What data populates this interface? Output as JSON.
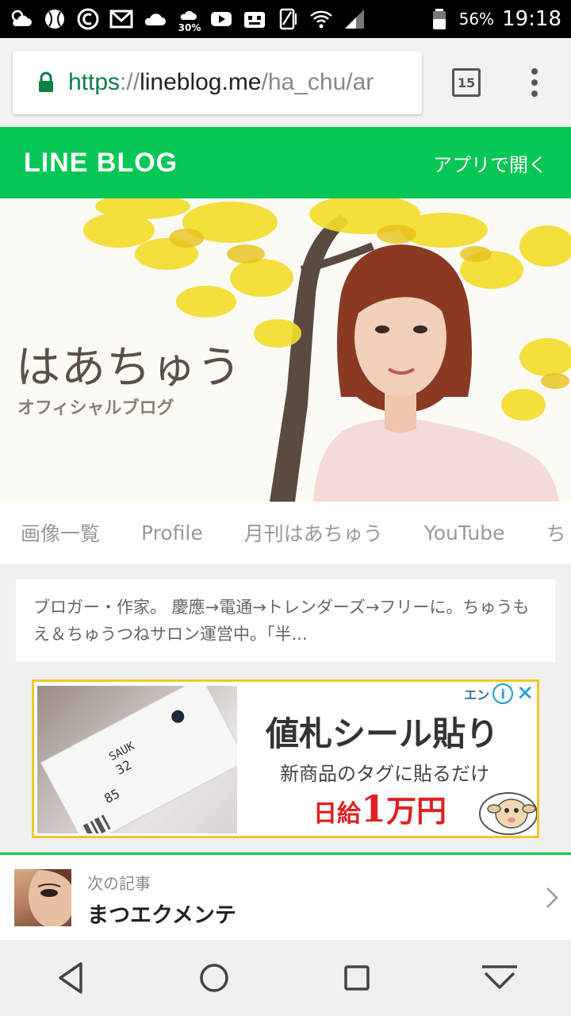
{
  "status_bar": {
    "notification_badge_text": "30%",
    "battery_percent": "56%",
    "time": "19:18",
    "icons": [
      "weather-icon",
      "baseball-icon",
      "cast-icon",
      "gmail-icon",
      "cloud-icon",
      "rain-chance-icon",
      "youtube-icon",
      "voicemail-icon",
      "vibrate-icon",
      "wifi-icon",
      "signal-icon",
      "battery-icon"
    ]
  },
  "browser": {
    "url_scheme": "https",
    "url_sep": "://",
    "url_host": "lineblog.me",
    "url_path": "/ha_chu/ar",
    "tab_count": "15"
  },
  "lineblog_header": {
    "logo": "LINE BLOG",
    "open_in_app": "アプリで開く",
    "color": "#06c755"
  },
  "hero": {
    "title": "はあちゅう",
    "subtitle": "オフィシャルブログ"
  },
  "nav_tabs": [
    "画像一覧",
    "Profile",
    "月刊はあちゅう",
    "YouTube",
    "ち"
  ],
  "description": "ブロガー・作家。 慶應→電通→トレンダーズ→フリーに。ちゅうもえ＆ちゅうつねサロン運営中。「半...",
  "ad": {
    "title": "値札シール貼り",
    "subtitle": "新商品のタグに貼るだけ",
    "pay_prefix": "日給",
    "pay_amount": "1",
    "pay_suffix": "万円",
    "choices_text": "エン",
    "info_label": "i",
    "close_label": "✕",
    "tag_text_1": "SAUK",
    "tag_text_2": "32",
    "tag_text_3": "85",
    "border_color": "#f5c62a"
  },
  "next_article": {
    "label": "次の記事",
    "title": "まつエクメンテ"
  }
}
